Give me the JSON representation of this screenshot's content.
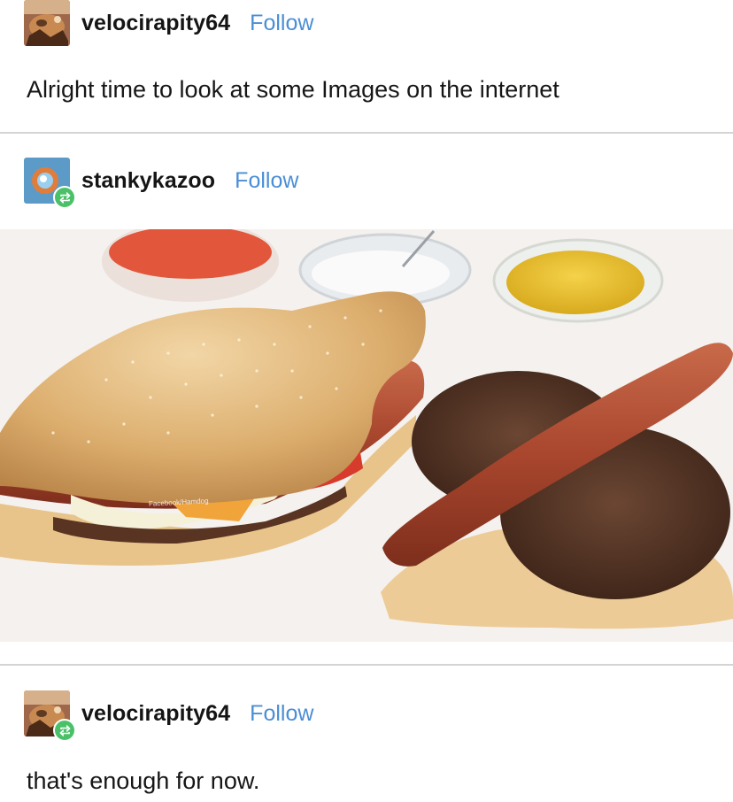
{
  "posts": [
    {
      "username": "velocirapity64",
      "follow_label": "Follow",
      "text": "Alright time to look at some Images on the internet"
    },
    {
      "username": "stankykazoo",
      "follow_label": "Follow"
    },
    {
      "username": "velocirapity64",
      "follow_label": "Follow",
      "text": "that's enough for now."
    }
  ],
  "image": {
    "watermark": "Facebook/Hamdog"
  },
  "colors": {
    "follow": "#4a8ed6",
    "reblog_badge": "#4ac168",
    "divider": "#d4d4d4"
  },
  "icons": {
    "reblog": "reblog-icon"
  }
}
